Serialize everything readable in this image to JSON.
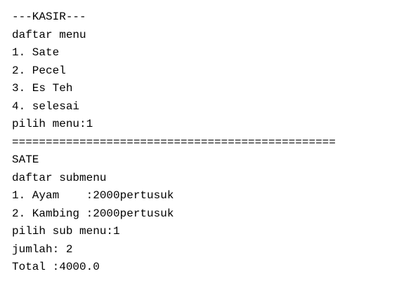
{
  "console": {
    "lines": [
      "---KASIR---",
      "daftar menu",
      "1. Sate",
      "2. Pecel",
      "3. Es Teh",
      "4. selesai",
      "pilih menu:1",
      "================================================",
      "SATE",
      "daftar submenu",
      "1. Ayam    :2000pertusuk",
      "2. Kambing :2000pertusuk",
      "pilih sub menu:1",
      "jumlah: 2",
      "Total :4000.0"
    ]
  }
}
